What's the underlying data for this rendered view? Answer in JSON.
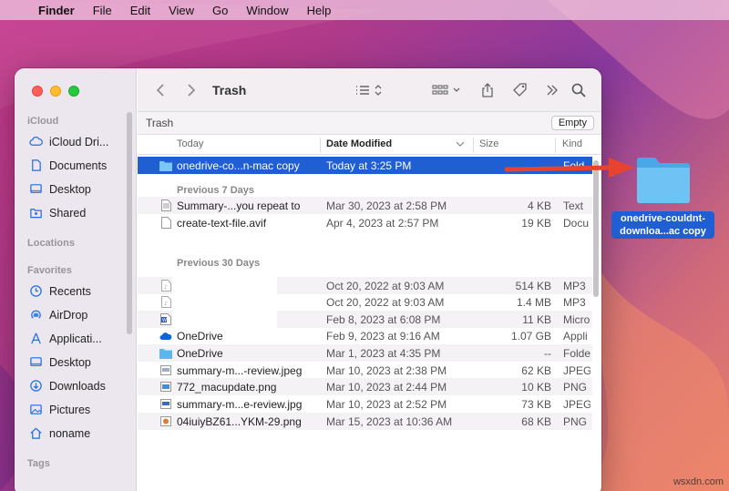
{
  "menubar": {
    "app": "Finder",
    "items": [
      "File",
      "Edit",
      "View",
      "Go",
      "Window",
      "Help"
    ]
  },
  "toolbar": {
    "title": "Trash"
  },
  "pathbar": {
    "title": "Trash",
    "empty_label": "Empty"
  },
  "sidebar": {
    "sections": {
      "icloud": "iCloud",
      "locations": "Locations",
      "favorites": "Favorites",
      "tags": "Tags"
    },
    "icloud_items": [
      {
        "label": "iCloud Dri...",
        "icon": "cloud-icon"
      },
      {
        "label": "Documents",
        "icon": "document-icon"
      },
      {
        "label": "Desktop",
        "icon": "desktop-icon"
      },
      {
        "label": "Shared",
        "icon": "shared-folder-icon"
      }
    ],
    "favorite_items": [
      {
        "label": "Recents",
        "icon": "clock-icon"
      },
      {
        "label": "AirDrop",
        "icon": "airdrop-icon"
      },
      {
        "label": "Applicati...",
        "icon": "applications-icon"
      },
      {
        "label": "Desktop",
        "icon": "desktop-icon"
      },
      {
        "label": "Downloads",
        "icon": "download-icon"
      },
      {
        "label": "Pictures",
        "icon": "pictures-icon"
      },
      {
        "label": "noname",
        "icon": "home-icon"
      }
    ]
  },
  "columns": {
    "name": "Today",
    "date": "Date Modified",
    "size": "Size",
    "kind": "Kind"
  },
  "groups": {
    "prev7": "Previous 7 Days",
    "prev30": "Previous 30 Days"
  },
  "rows": [
    {
      "name": "onedrive-co...n-mac copy",
      "date": "Today at 3:25 PM",
      "size": "",
      "kind": "Fold",
      "icon": "folder-icon"
    },
    {
      "name": "Summary-...you repeat to",
      "date": "Mar 30, 2023 at 2:58 PM",
      "size": "4 KB",
      "kind": "Text",
      "icon": "text-file-icon"
    },
    {
      "name": "create-text-file.avif",
      "date": "Apr 4, 2023 at 2:57 PM",
      "size": "19 KB",
      "kind": "Docu",
      "icon": "file-icon"
    },
    {
      "name": "",
      "date": "Oct 20, 2022 at 9:03 AM",
      "size": "514 KB",
      "kind": "MP3",
      "icon": "audio-file-icon"
    },
    {
      "name": "",
      "date": "Oct 20, 2022 at 9:03 AM",
      "size": "1.4 MB",
      "kind": "MP3",
      "icon": "audio-file-icon"
    },
    {
      "name": "",
      "date": "Feb 8, 2023 at 6:08 PM",
      "size": "11 KB",
      "kind": "Micro",
      "icon": "word-doc-icon"
    },
    {
      "name": "OneDrive",
      "date": "Feb 9, 2023 at 9:16 AM",
      "size": "1.07 GB",
      "kind": "Appli",
      "icon": "onedrive-app-icon"
    },
    {
      "name": "OneDrive",
      "date": "Mar 1, 2023 at 4:35 PM",
      "size": "--",
      "kind": "Folde",
      "icon": "folder-icon"
    },
    {
      "name": "summary-m...-review.jpeg",
      "date": "Mar 10, 2023 at 2:38 PM",
      "size": "62 KB",
      "kind": "JPEG",
      "icon": "image-file-icon"
    },
    {
      "name": "772_macupdate.png",
      "date": "Mar 10, 2023 at 2:44 PM",
      "size": "10 KB",
      "kind": "PNG",
      "icon": "image-file-icon"
    },
    {
      "name": "summary-m...e-review.jpg",
      "date": "Mar 10, 2023 at 2:52 PM",
      "size": "73 KB",
      "kind": "JPEG",
      "icon": "image-file-icon"
    },
    {
      "name": "04iuiyBZ61...YKM-29.png",
      "date": "Mar 15, 2023 at 10:36 AM",
      "size": "68 KB",
      "kind": "PNG",
      "icon": "image-file-icon"
    }
  ],
  "desktop_item": {
    "label_line1": "onedrive-couldnt-",
    "label_line2": "downloa...ac copy"
  },
  "watermark": "wsxdn.com",
  "colors": {
    "selection": "#1f5fd3",
    "arrow": "#e8432e",
    "folder": "#5ab8f0"
  }
}
